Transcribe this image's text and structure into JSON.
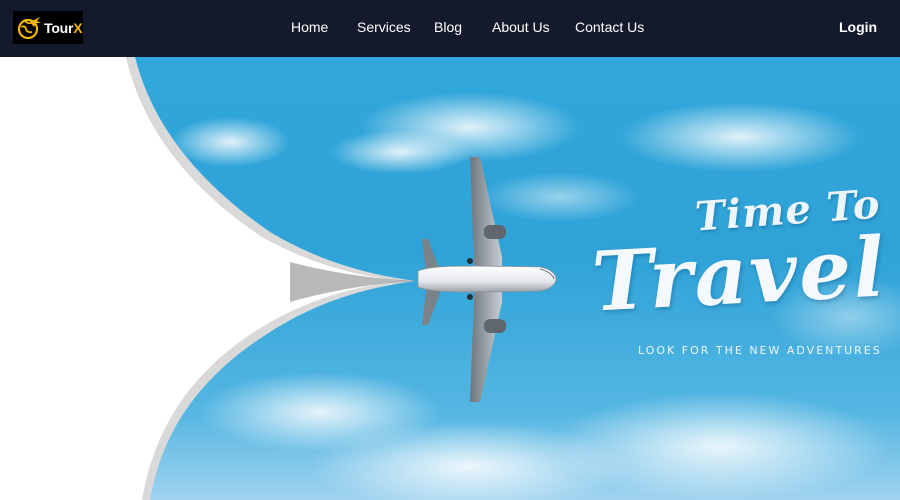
{
  "brand": {
    "name_prefix": "Tour",
    "name_suffix": "X",
    "accent_color": "#f2b705",
    "icon": "globe-plane-icon"
  },
  "nav": {
    "items": [
      {
        "label": "Home"
      },
      {
        "label": "Services"
      },
      {
        "label": "Blog"
      },
      {
        "label": "About Us"
      },
      {
        "label": "Contact Us"
      }
    ],
    "login_label": "Login",
    "background": "#141a2b"
  },
  "hero": {
    "headline_line1": "Time To",
    "headline_line2": "Travel",
    "tagline": "LOOK FOR THE NEW ADVENTURES",
    "sky_color": "#31a6da",
    "image": "airplane-over-clouds"
  }
}
